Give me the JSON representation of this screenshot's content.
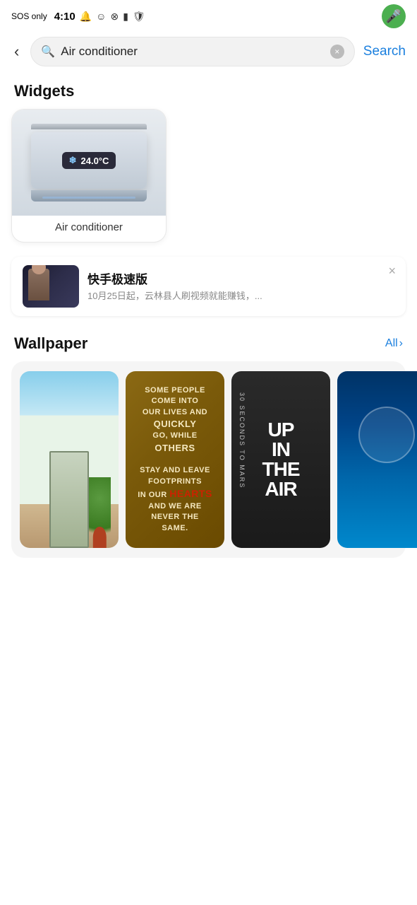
{
  "statusBar": {
    "sosText": "SOS only",
    "time": "4:10",
    "icons": [
      "bell",
      "message",
      "x-circle",
      "battery",
      "shield"
    ]
  },
  "searchBar": {
    "backLabel": "‹",
    "inputValue": "Air conditioner",
    "clearLabel": "×",
    "searchLabel": "Search",
    "placeholder": "Search"
  },
  "widgets": {
    "sectionLabel": "Widgets",
    "airConditioner": {
      "displayTemp": "24.0°C",
      "widgetLabel": "Air conditioner"
    }
  },
  "adBanner": {
    "title": "快手极速版",
    "subtitle": "10月25日起，云林县人刷视频就能赚钱，...",
    "closeLabel": "×"
  },
  "wallpaper": {
    "sectionLabel": "Wallpaper",
    "allLabel": "All",
    "chevron": "›",
    "items": [
      {
        "id": "wp1",
        "type": "room"
      },
      {
        "id": "wp2",
        "type": "text",
        "lines": [
          "SOME",
          "PEOPLE",
          "COME INTO",
          "OUR LIVES AND",
          "QUICKLY GO, WHILE",
          "OTHERS",
          "STAY AND LEAVE",
          "FOOTPRINTS",
          "IN OUR",
          "HEARTS",
          "AND WE ARE",
          "NEVER THE",
          "SAME."
        ]
      },
      {
        "id": "wp3",
        "type": "dark-text",
        "mainText": [
          "UP",
          "IN",
          "THE",
          "AIR"
        ],
        "subText": "30 SECONDS TO MARS"
      },
      {
        "id": "wp4",
        "type": "ocean"
      }
    ]
  }
}
